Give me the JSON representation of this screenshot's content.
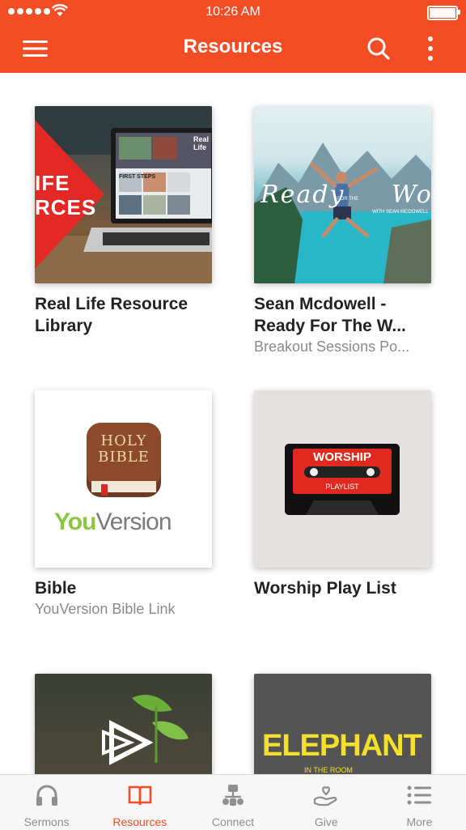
{
  "status_bar": {
    "time": "10:26 AM"
  },
  "header": {
    "title": "Resources"
  },
  "items": [
    {
      "title": "Real Life Resource Library",
      "title_lines": "Real Life Resource\nLibrary",
      "subtitle": "",
      "art": {
        "overlay_text": "IFE\nRCES",
        "screen_text": "Real Life",
        "screen_label": "FIRST STEPS"
      }
    },
    {
      "title": "Sean Mcdowell - Ready For The W...",
      "title_lines": "Sean Mcdowell -\nReady For The W...",
      "subtitle": "Breakout Sessions Po...",
      "art": {
        "script_text": "Ready World",
        "small_text": "FOR THE",
        "credit": "WITH SEAN MCDOWELL"
      }
    },
    {
      "title": "Bible",
      "title_lines": "Bible",
      "subtitle": "YouVersion Bible Link",
      "art": {
        "book_text_1": "HOLY",
        "book_text_2": "BIBLE",
        "brand_you": "You",
        "brand_version": "Version"
      }
    },
    {
      "title": "Worship Play List",
      "title_lines": "Worship Play List",
      "subtitle": "",
      "art": {
        "label_top": "WORSHIP",
        "label_bottom": "PLAYLIST"
      }
    },
    {
      "title": "",
      "title_lines": "",
      "subtitle": "",
      "art": {}
    },
    {
      "title": "",
      "title_lines": "",
      "subtitle": "",
      "art": {
        "big_text": "ELEPHANT",
        "small_text": "IN THE ROOM"
      }
    }
  ],
  "tabs": [
    {
      "label": "Sermons",
      "icon": "headphones-icon",
      "active": false
    },
    {
      "label": "Resources",
      "icon": "book-icon",
      "active": true
    },
    {
      "label": "Connect",
      "icon": "connect-icon",
      "active": false
    },
    {
      "label": "Give",
      "icon": "give-icon",
      "active": false
    },
    {
      "label": "More",
      "icon": "list-icon",
      "active": false
    }
  ],
  "colors": {
    "accent": "#f44c25",
    "inactive": "#8e8e93"
  }
}
